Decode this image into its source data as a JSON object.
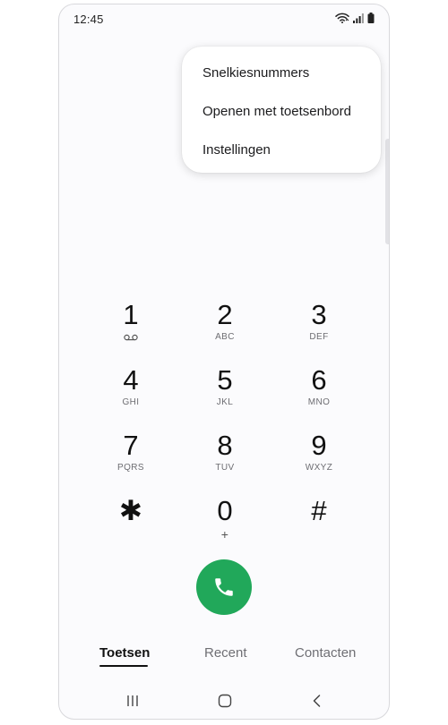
{
  "status_bar": {
    "time": "12:45",
    "icons": [
      "wifi-icon",
      "signal-icon",
      "battery-icon"
    ]
  },
  "menu": {
    "items": [
      {
        "label": "Snelkiesnummers"
      },
      {
        "label": "Openen met toetsenbord"
      },
      {
        "label": "Instellingen"
      }
    ]
  },
  "keypad": {
    "keys": [
      {
        "digit": "1",
        "sub": "",
        "sub_icon": "voicemail-icon"
      },
      {
        "digit": "2",
        "sub": "ABC"
      },
      {
        "digit": "3",
        "sub": "DEF"
      },
      {
        "digit": "4",
        "sub": "GHI"
      },
      {
        "digit": "5",
        "sub": "JKL"
      },
      {
        "digit": "6",
        "sub": "MNO"
      },
      {
        "digit": "7",
        "sub": "PQRS"
      },
      {
        "digit": "8",
        "sub": "TUV"
      },
      {
        "digit": "9",
        "sub": "WXYZ"
      },
      {
        "digit": "✱",
        "sub": ""
      },
      {
        "digit": "0",
        "sub": "+"
      },
      {
        "digit": "#",
        "sub": ""
      }
    ]
  },
  "call_button": {
    "icon": "phone-icon",
    "color": "#21a85a"
  },
  "tabs": [
    {
      "label": "Toetsen",
      "active": true
    },
    {
      "label": "Recent",
      "active": false
    },
    {
      "label": "Contacten",
      "active": false
    }
  ],
  "nav_bar": {
    "icons": [
      "recent-apps-icon",
      "home-icon",
      "back-icon"
    ]
  }
}
